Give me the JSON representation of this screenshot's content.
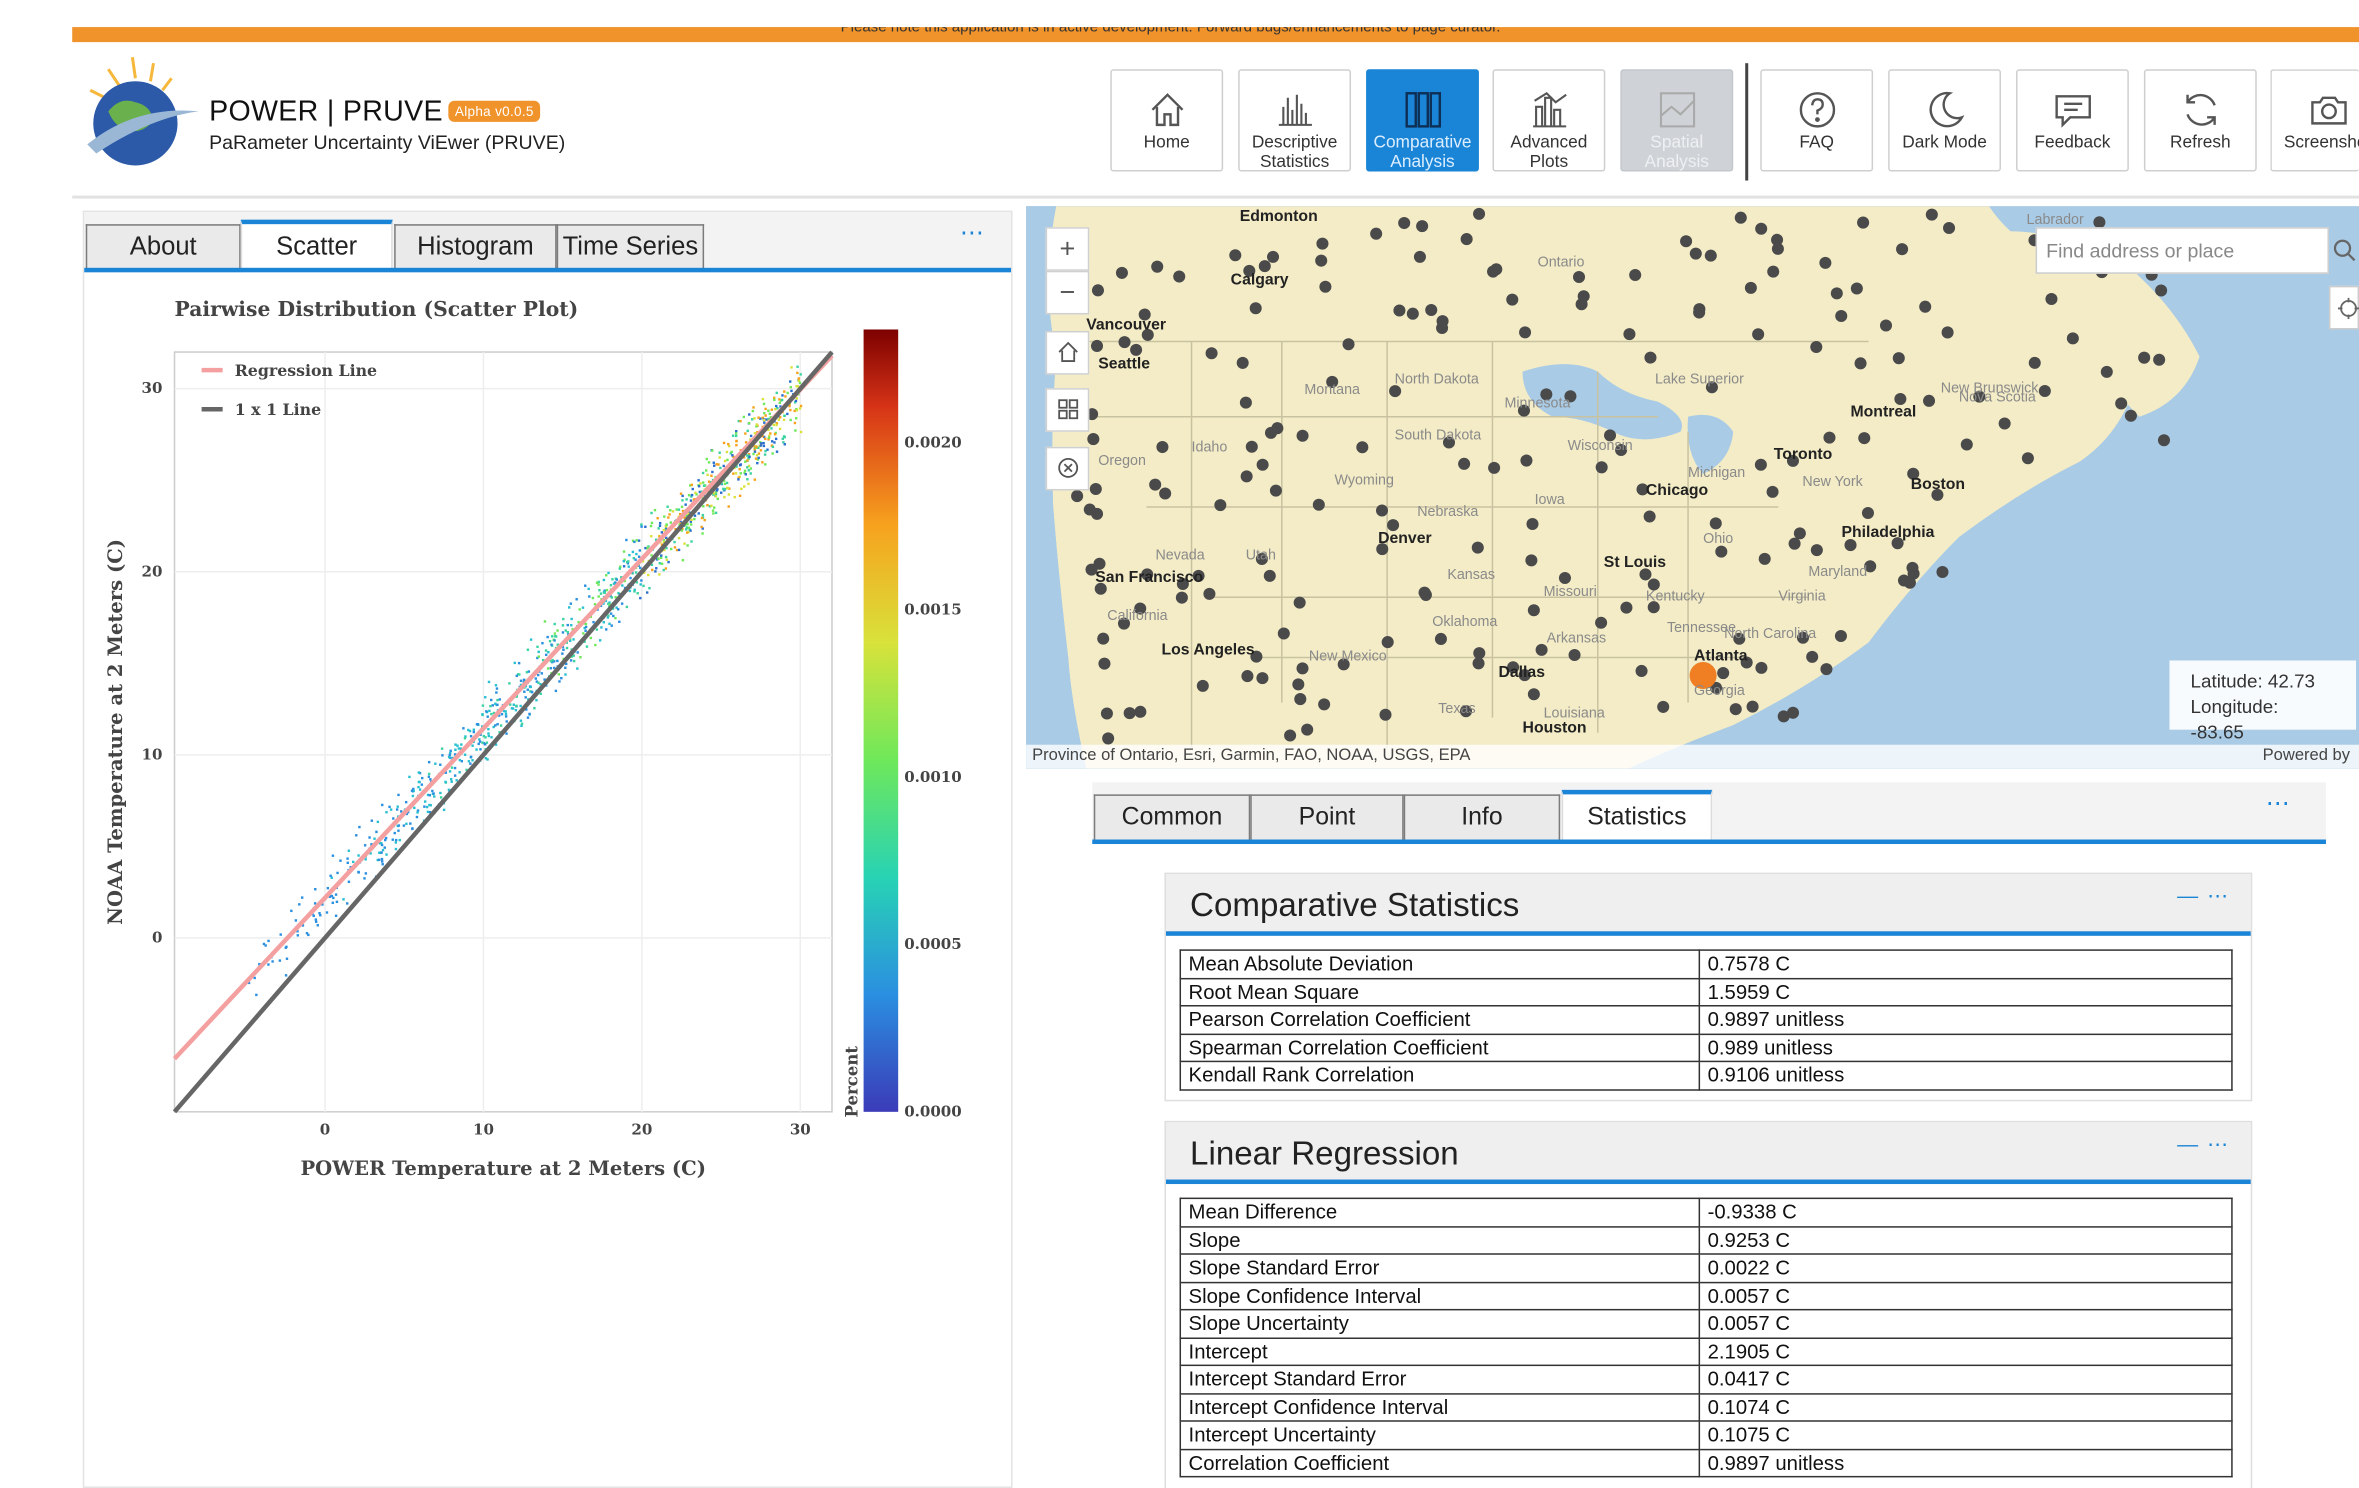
{
  "banner": {
    "text": "Please note this application is in active development. Forward bugs/enhancements to page curator."
  },
  "app": {
    "title": "POWER | PRUVE",
    "badge": "Alpha v0.0.5",
    "subtitle": "PaRameter Uncertainty ViEwer (PRUVE)"
  },
  "nav": [
    {
      "label": "Home",
      "icon": "home-icon"
    },
    {
      "label": "Descriptive Statistics",
      "icon": "bar-chart-icon"
    },
    {
      "label": "Comparative Analysis",
      "icon": "comparative-icon",
      "active": true
    },
    {
      "label": "Advanced Plots",
      "icon": "advanced-plots-icon"
    },
    {
      "label": "Spatial Analysis",
      "icon": "map-icon",
      "disabled": true
    },
    {
      "label": "FAQ",
      "icon": "question-icon"
    },
    {
      "label": "Dark Mode",
      "icon": "moon-icon"
    },
    {
      "label": "Feedback",
      "icon": "speech-icon"
    },
    {
      "label": "Refresh",
      "icon": "refresh-icon"
    },
    {
      "label": "Screensho",
      "icon": "camera-icon"
    }
  ],
  "left_tabs": [
    "About",
    "Scatter",
    "Histogram",
    "Time Series"
  ],
  "left_active_tab": "Scatter",
  "map": {
    "search_placeholder": "Find address or place",
    "latitude_text": "Latitude: 42.73",
    "longitude_text": "Longitude: -83.65",
    "attribution": "Province of Ontario, Esri, Garmin, FAO, NOAA, USGS, EPA",
    "powered": "Powered by",
    "labels": [
      "Edmonton",
      "Calgary",
      "Vancouver",
      "Seattle",
      "Montana",
      "North Dakota",
      "Minnesota",
      "Ontario",
      "Lake Superior",
      "Idaho",
      "Oregon",
      "South Dakota",
      "Wisconsin",
      "Michigan",
      "Toronto",
      "Montreal",
      "New York",
      "Boston",
      "Wyoming",
      "Iowa",
      "Chicago",
      "Nebraska",
      "Denver",
      "Ohio",
      "Philadelphia",
      "Nevada",
      "Utah",
      "San Francisco",
      "Kansas",
      "St Louis",
      "Missouri",
      "Kentucky",
      "Virginia",
      "California",
      "Oklahoma",
      "Tennessee",
      "North Carolina",
      "Los Angeles",
      "New Mexico",
      "Arkansas",
      "Atlanta",
      "Dallas",
      "Texas",
      "Louisiana",
      "Georgia",
      "Houston",
      "Nova Scotia",
      "New Brunswick",
      "Labrador",
      "Maryland"
    ]
  },
  "right_tabs": [
    "Common",
    "Point",
    "Info",
    "Statistics"
  ],
  "right_active_tab": "Statistics",
  "comparative": {
    "title": "Comparative Statistics",
    "rows": [
      [
        "Mean Absolute Deviation",
        "0.7578 C"
      ],
      [
        "Root Mean Square",
        "1.5959 C"
      ],
      [
        "Pearson Correlation Coefficient",
        "0.9897 unitless"
      ],
      [
        "Spearman Correlation Coefficient",
        "0.989 unitless"
      ],
      [
        "Kendall Rank Correlation",
        "0.9106 unitless"
      ]
    ]
  },
  "regression": {
    "title": "Linear Regression",
    "rows": [
      [
        "Mean Difference",
        "-0.9338 C"
      ],
      [
        "Slope",
        "0.9253 C"
      ],
      [
        "Slope Standard Error",
        "0.0022 C"
      ],
      [
        "Slope Confidence Interval",
        "0.0057 C"
      ],
      [
        "Slope Uncertainty",
        "0.0057 C"
      ],
      [
        "Intercept",
        "2.1905 C"
      ],
      [
        "Intercept Standard Error",
        "0.0417 C"
      ],
      [
        "Intercept Confidence Interval",
        "0.1074 C"
      ],
      [
        "Intercept Uncertainty",
        "0.1075 C"
      ],
      [
        "Correlation Coefficient",
        "0.9897 unitless"
      ]
    ]
  },
  "chart_data": {
    "type": "scatter",
    "title": "Pairwise Distribution (Scatter Plot)",
    "xlabel": "POWER Temperature at 2 Meters (C)",
    "ylabel": "NOAA Temperature at 2 Meters (C)",
    "xlim": [
      -9.5,
      32
    ],
    "ylim": [
      -9.5,
      32
    ],
    "xticks": [
      "0",
      "10",
      "20",
      "30"
    ],
    "yticks": [
      "0",
      "10",
      "20",
      "30"
    ],
    "legend": [
      "Regression Line",
      "1 x 1 Line"
    ],
    "legend_position": "top-left",
    "regression": {
      "slope": 0.9253,
      "intercept": 2.1905
    },
    "colorbar": {
      "label": "Percent",
      "ticks": [
        "0.0000",
        "0.0005",
        "0.0010",
        "0.0015",
        "0.0020"
      ]
    },
    "series_color_regression": "#f4a0a0",
    "series_color_identity": "#666666"
  }
}
